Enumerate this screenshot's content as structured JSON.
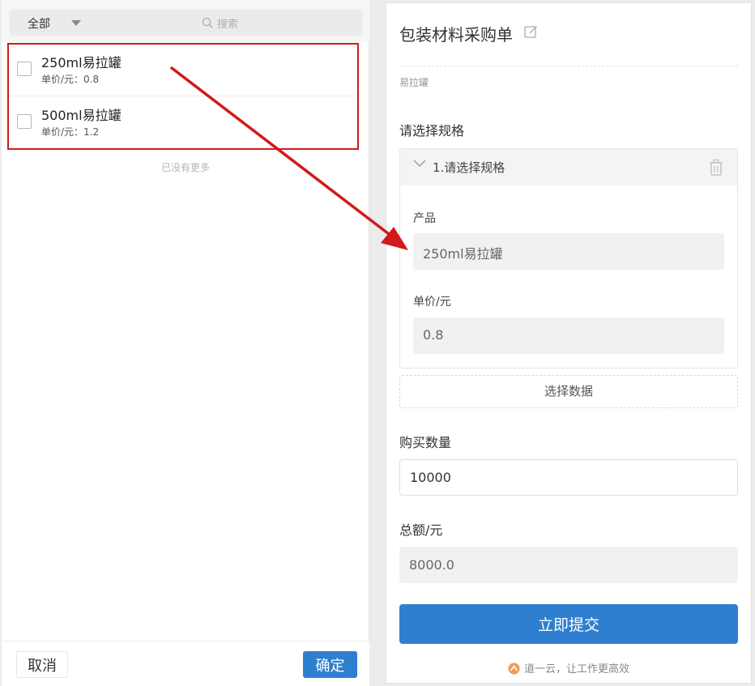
{
  "list_panel": {
    "filter_label": "全部",
    "search_placeholder": "搜索",
    "items": [
      {
        "name": "250ml易拉罐",
        "price": "单价/元：0.8"
      },
      {
        "name": "500ml易拉罐",
        "price": "单价/元：1.2"
      }
    ],
    "no_more": "已没有更多",
    "cancel_label": "取消",
    "confirm_label": "确定"
  },
  "form": {
    "title": "包装材料采购单",
    "subtitle": "易拉罐",
    "spec_label": "请选择规格",
    "spec_item_title": "1.请选择规格",
    "product_label": "产品",
    "product_value": "250ml易拉罐",
    "unit_price_label": "单价/元",
    "unit_price_value": "0.8",
    "select_data_label": "选择数据",
    "quantity_label": "购买数量",
    "quantity_value": "10000",
    "total_label": "总额/元",
    "total_value": "8000.0",
    "submit_label": "立即提交",
    "brand_text": "道一云，让工作更高效"
  },
  "colors": {
    "primary": "#2f7fd0",
    "highlight": "#d11a1a"
  },
  "icons": [
    "chevron-down-icon",
    "search-icon",
    "edit-icon",
    "trash-icon",
    "brand-logo-icon",
    "arrow-annotation"
  ]
}
